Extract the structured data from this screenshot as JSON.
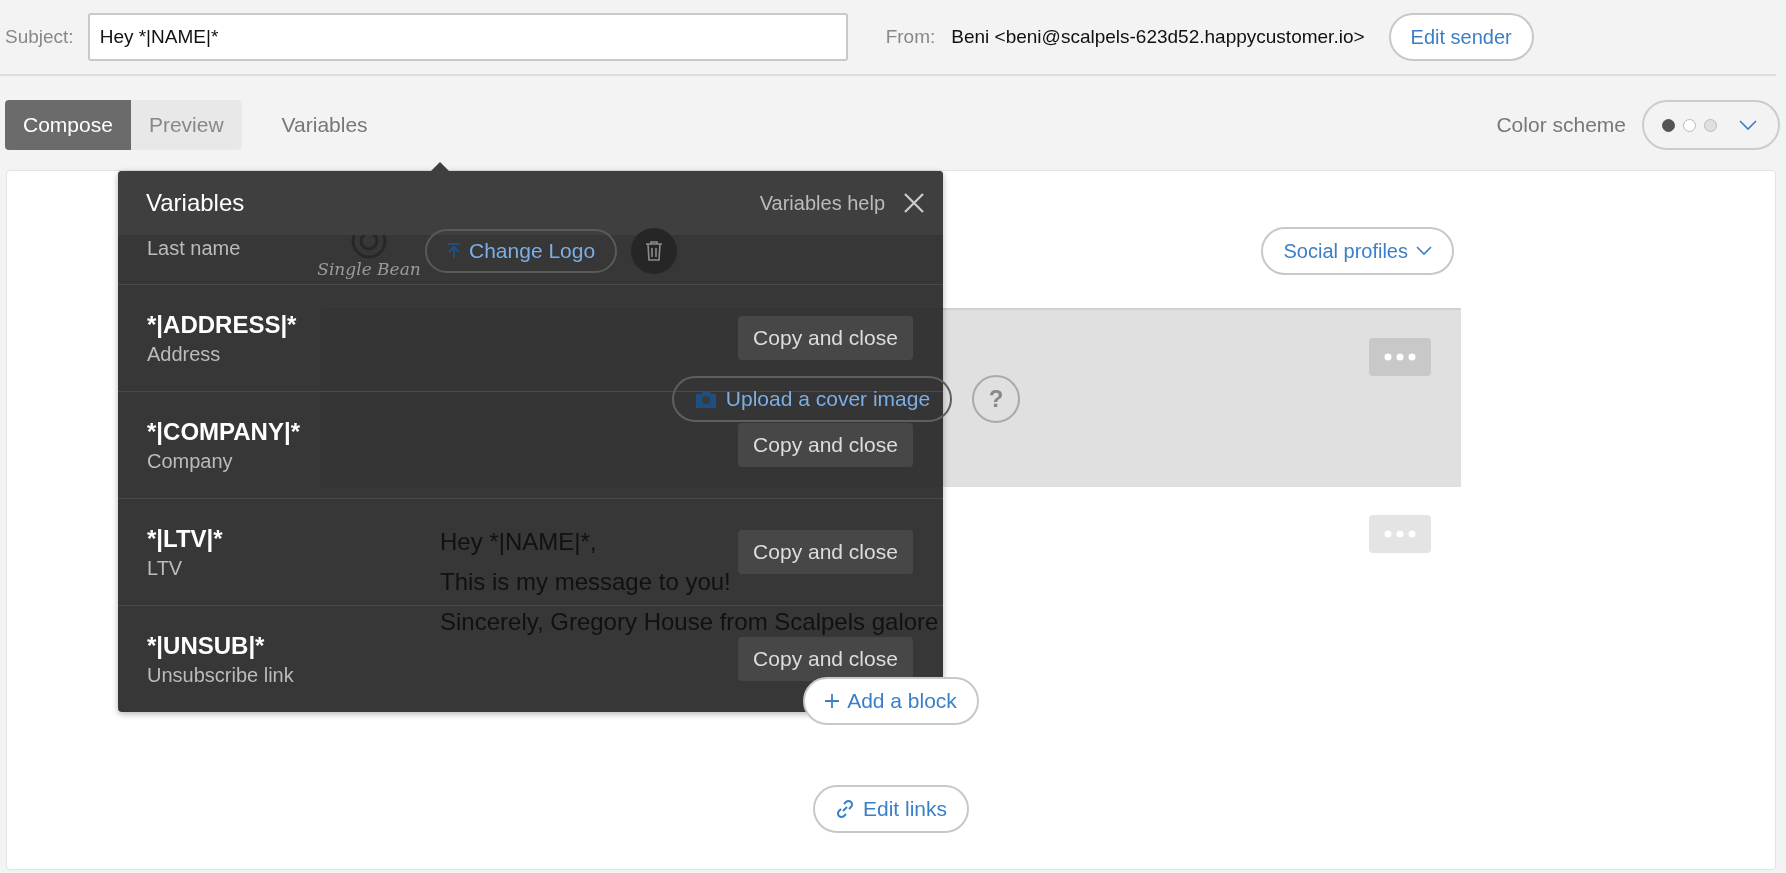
{
  "subject": {
    "label": "Subject:",
    "value": "Hey *|NAME|*"
  },
  "from": {
    "label": "From:",
    "value": "Beni <beni@scalpels-623d52.happycustomer.io>",
    "button": "Edit sender"
  },
  "tabs": [
    {
      "label": "Compose",
      "selected": true
    },
    {
      "label": "Preview",
      "selected": false
    }
  ],
  "variables_toggle": {
    "label": "Variables",
    "expanded": true
  },
  "color_scheme": {
    "label": "Color scheme",
    "options": [
      {
        "color": "#555555",
        "selected": true
      },
      {
        "color": "#ffffff",
        "selected": false
      },
      {
        "color": "#e0e0e0",
        "selected": false
      }
    ]
  },
  "editor": {
    "logo_text": "Single Bean",
    "change_logo": "Change Logo",
    "social_profiles": "Social profiles",
    "cover_upload": "Upload a cover image",
    "help": "?",
    "message": [
      "Hey *|NAME|*,",
      "This is my message to you!",
      "Sincerely, Gregory House from Scalpels galore"
    ],
    "add_block": "Add a block",
    "edit_links": "Edit links"
  },
  "variables_panel": {
    "title": "Variables",
    "help": "Variables help",
    "rows": [
      {
        "description": "Last name"
      },
      {
        "name": "*|ADDRESS|*",
        "description": "Address",
        "copy_label": "Copy and close"
      },
      {
        "name": "*|COMPANY|*",
        "description": "Company",
        "copy_label": "Copy and close"
      },
      {
        "name": "*|LTV|*",
        "description": "LTV",
        "copy_label": "Copy and close"
      },
      {
        "name": "*|UNSUB|*",
        "description": "Unsubscribe link",
        "copy_label": "Copy and close"
      }
    ]
  }
}
